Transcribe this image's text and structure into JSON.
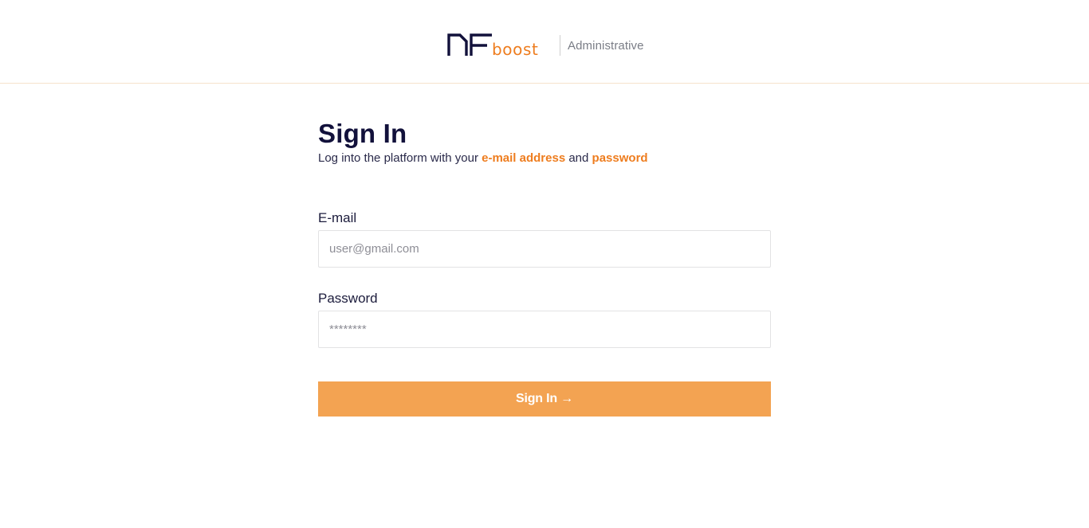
{
  "header": {
    "logo_text_primary": "NF",
    "logo_text_secondary": "boost",
    "subtitle": "Administrative"
  },
  "form": {
    "title": "Sign In",
    "subtitle_prefix": "Log into the platform with your ",
    "subtitle_email": "e-mail address",
    "subtitle_and": " and ",
    "subtitle_password": "password",
    "email_label": "E-mail",
    "email_placeholder": "user@gmail.com",
    "password_label": "Password",
    "password_placeholder": "********",
    "submit_label": "Sign In →"
  },
  "colors": {
    "navy": "#12113b",
    "orange": "#ee7d1f",
    "button": "#f3a352"
  }
}
